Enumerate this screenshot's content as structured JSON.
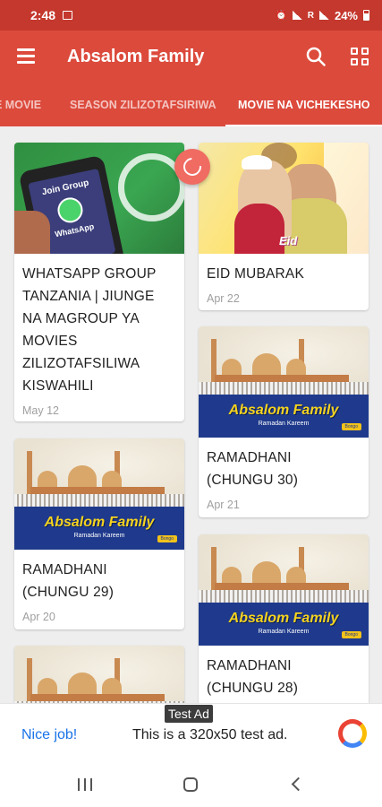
{
  "status_bar": {
    "time": "2:48",
    "battery": "24%",
    "network_label": "R"
  },
  "app_bar": {
    "title": "Absalom Family",
    "menu_icon": "hamburger-menu-icon",
    "search_icon": "search-icon",
    "grid_icon": "grid-view-icon",
    "background_color": "#dc4a3c"
  },
  "tabs": [
    {
      "label": "E MOVIE",
      "active": false
    },
    {
      "label": "SEASON ZILIZOTAFSIRIWA",
      "active": false
    },
    {
      "label": "MOVIE NA VICHEKESHO",
      "active": true
    }
  ],
  "posts": [
    {
      "title": "WHATSAPP GROUP TANZANIA | JIUNGE NA MAGROUP YA MOVIES ZILIZOTAFSILIWA KISWAHILI",
      "date": "May 12",
      "thumb": {
        "line1": "Join Group",
        "line2": "WhatsApp"
      }
    },
    {
      "title": "EID MUBARAK",
      "date": "Apr 22",
      "thumb": {
        "caption": "Eid"
      }
    },
    {
      "title": "RAMADHANI (CHUNGU 30)",
      "date": "Apr 21",
      "thumb": {
        "brand": "Absalom Family",
        "sub": "Ramadan Kareem",
        "tag": "Bongo"
      }
    },
    {
      "title": "RAMADHANI (CHUNGU 29)",
      "date": "Apr 20",
      "thumb": {
        "brand": "Absalom Family",
        "sub": "Ramadan Kareem",
        "tag": "Bongo"
      }
    },
    {
      "title": "RAMADHANI (CHUNGU 28)",
      "date": "",
      "thumb": {
        "brand": "Absalom Family",
        "sub": "Ramadan Kareem",
        "tag": "Bongo"
      }
    },
    {
      "title": "",
      "date": "",
      "thumb": {
        "brand": "",
        "sub": "",
        "tag": ""
      }
    }
  ],
  "ad": {
    "label": "Test Ad",
    "left_text": "Nice job!",
    "body_text": "This is a 320x50 test ad."
  }
}
